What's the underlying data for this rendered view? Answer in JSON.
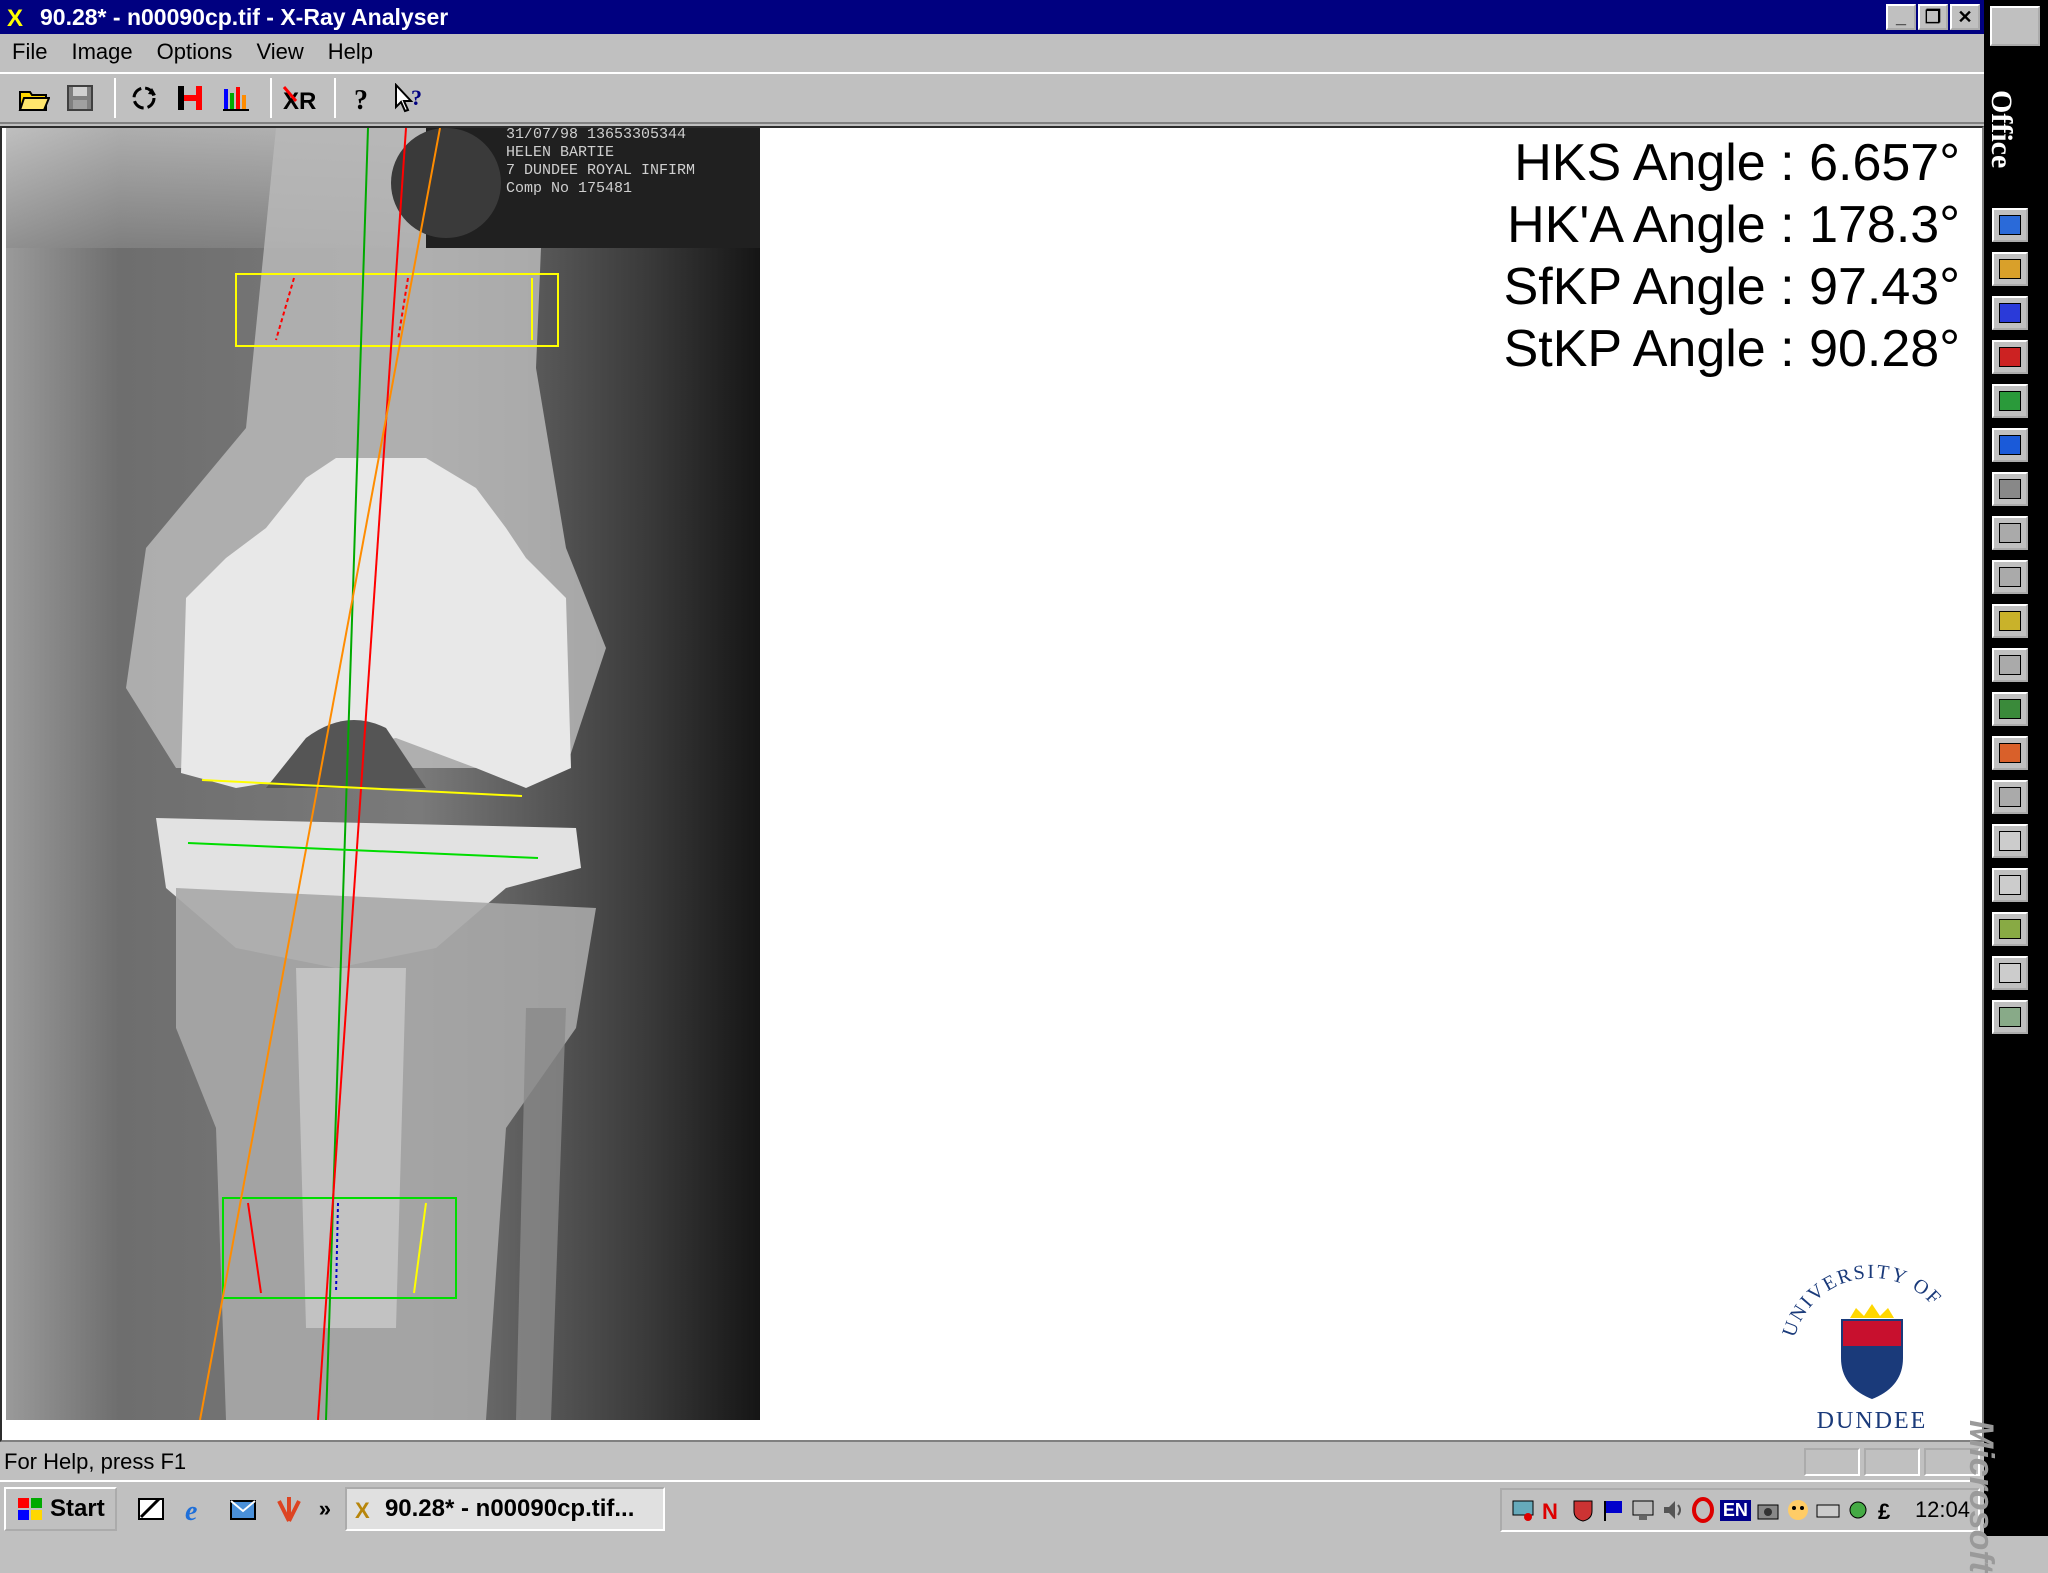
{
  "window": {
    "title": "90.28* - n00090cp.tif - X-Ray Analyser",
    "minimize": "_",
    "restore": "❐",
    "close": "✕"
  },
  "menu": [
    "File",
    "Image",
    "Options",
    "View",
    "Help"
  ],
  "toolbar": {
    "icons": [
      "open-icon",
      "save-icon",
      "rotate-icon",
      "measure-icon",
      "histogram-icon",
      "xr-icon",
      "help-icon",
      "context-help-icon"
    ],
    "xr_label": "XR"
  },
  "xray": {
    "header_lines": [
      "31/07/98   13653305344",
      "HELEN BARTIE",
      "7  DUNDEE ROYAL  INFIRM",
      "Comp   No   175481"
    ]
  },
  "angles": [
    {
      "label": "HKS Angle",
      "value": "6.657°"
    },
    {
      "label": "HK'A Angle",
      "value": "178.3°"
    },
    {
      "label": "SfKP Angle",
      "value": "97.43°"
    },
    {
      "label": "StKP Angle",
      "value": "90.28°"
    }
  ],
  "logo": {
    "top_text": "UNIVERSITY OF",
    "bottom_text": "DUNDEE"
  },
  "status": {
    "help_text": "For Help, press F1"
  },
  "taskbar": {
    "start_label": "Start",
    "task_label": "90.28* - n00090cp.tif...",
    "tray_lang": "EN",
    "clock": "12:04",
    "more": "»"
  },
  "office_bar": {
    "title": "Office",
    "brand": "Microsoft",
    "items": 20
  },
  "colors": {
    "title_bg": "#000080",
    "face": "#c0c0c0",
    "accent_yellow": "#ffff00",
    "accent_red": "#ff0000",
    "accent_green": "#00cc00",
    "accent_orange": "#ff8c00"
  }
}
